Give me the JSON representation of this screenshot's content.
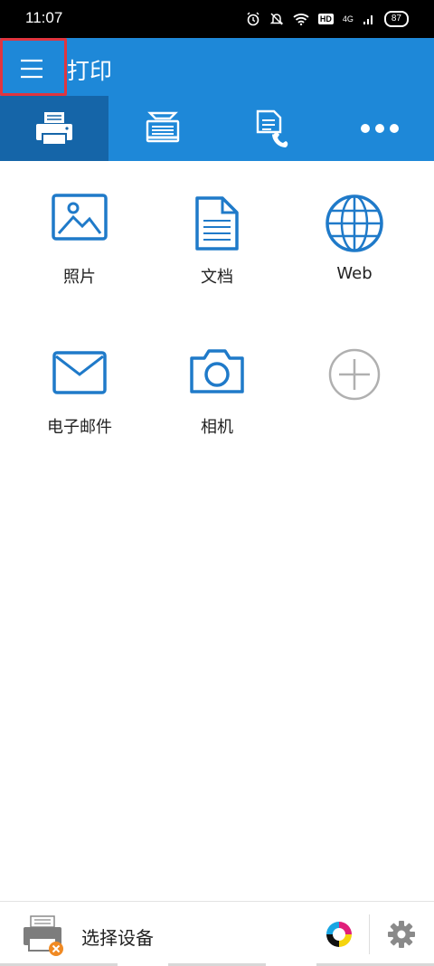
{
  "status": {
    "time": "11:07",
    "battery": "87",
    "network": "4G",
    "hd": "HD"
  },
  "app": {
    "title": "打印"
  },
  "tabs": [
    {
      "icon": "printer-icon",
      "active": true
    },
    {
      "icon": "scanner-icon",
      "active": false
    },
    {
      "icon": "fax-icon",
      "active": false
    },
    {
      "icon": "more-icon",
      "active": false
    }
  ],
  "tiles": [
    {
      "label": "照片",
      "icon": "photo-icon"
    },
    {
      "label": "文档",
      "icon": "document-icon"
    },
    {
      "label": "Web",
      "icon": "globe-icon"
    },
    {
      "label": "电子邮件",
      "icon": "email-icon"
    },
    {
      "label": "相机",
      "icon": "camera-icon"
    },
    {
      "label": "",
      "icon": "add-icon"
    }
  ],
  "bottom": {
    "device_label": "选择设备"
  },
  "colors": {
    "accent": "#1e88d8",
    "active_tab": "#1565a8",
    "icon_blue": "#1f7ac9",
    "highlight": "#e0353f"
  }
}
